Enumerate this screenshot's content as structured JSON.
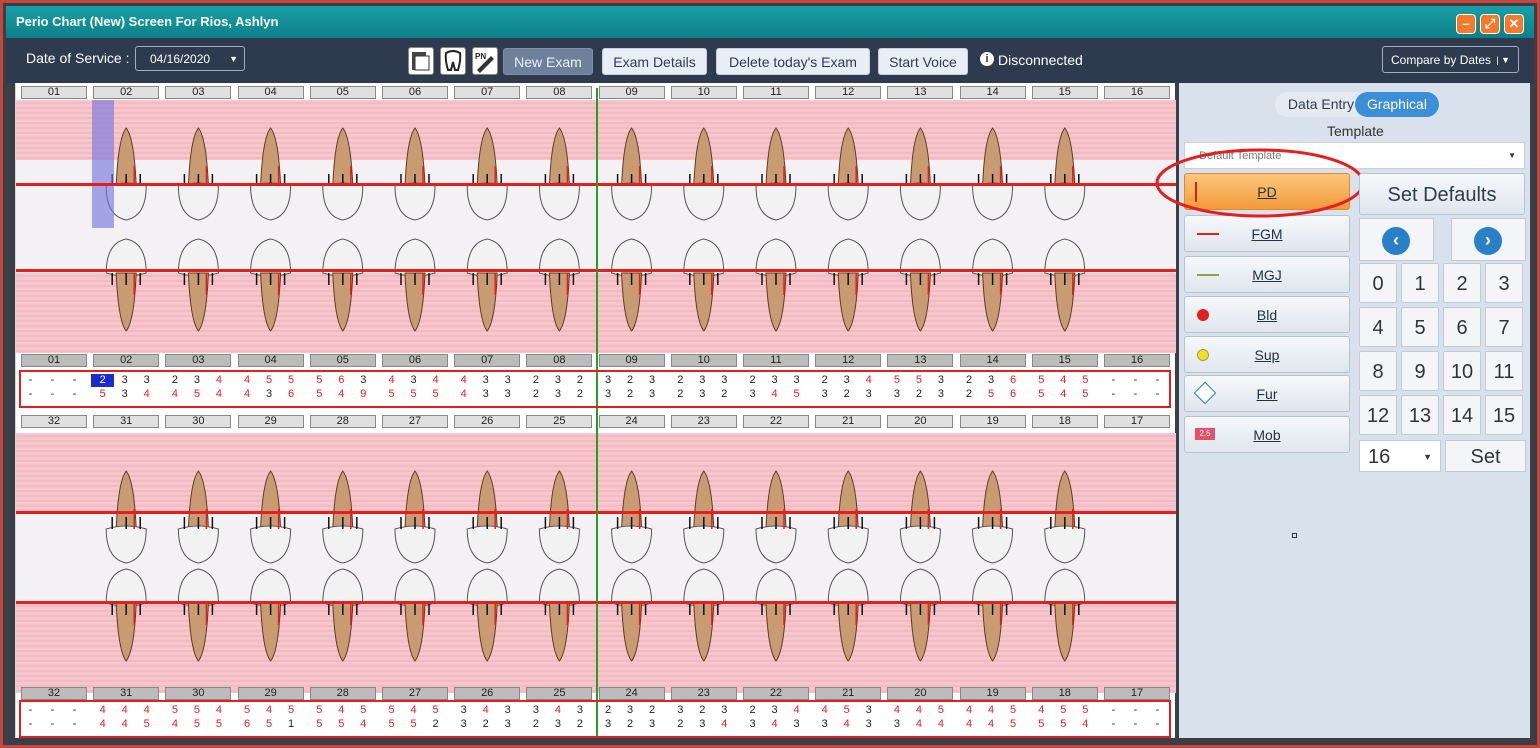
{
  "window": {
    "title": "Perio Chart (New) Screen For Rios, Ashlyn"
  },
  "toolbar": {
    "dos_label": "Date of Service :",
    "dos_value": "04/16/2020",
    "new_exam": "New Exam",
    "exam_details": "Exam Details",
    "delete_exam": "Delete today's Exam",
    "start_voice": "Start Voice",
    "status": "Disconnected",
    "compare": "Compare by Dates"
  },
  "panel": {
    "data_entry": "Data Entry",
    "graphical": "Graphical",
    "template_label": "Template",
    "template_value": "Default Template",
    "set_defaults": "Set Defaults",
    "set": "Set",
    "select_value": "16",
    "buttons": [
      "PD",
      "FGM",
      "MGJ",
      "Bld",
      "Sup",
      "Fur",
      "Mob"
    ],
    "mob_badge": "2.5",
    "numpad": [
      "0",
      "1",
      "2",
      "3",
      "4",
      "5",
      "6",
      "7",
      "8",
      "9",
      "10",
      "11",
      "12",
      "13",
      "14",
      "15"
    ]
  },
  "colors": {
    "accent": "#3a8fd6",
    "pd_active": "#f6a84a",
    "gum": "#f7c6cc",
    "line": "#e32020",
    "midline": "#2a9a2a"
  },
  "upper_teeth": [
    "01",
    "02",
    "03",
    "04",
    "05",
    "06",
    "07",
    "08",
    "09",
    "10",
    "11",
    "12",
    "13",
    "14",
    "15",
    "16"
  ],
  "lower_teeth": [
    "32",
    "31",
    "30",
    "29",
    "28",
    "27",
    "26",
    "25",
    "24",
    "23",
    "22",
    "21",
    "20",
    "19",
    "18",
    "17"
  ],
  "upper_rows": [
    [
      [
        "-",
        "-",
        "-"
      ],
      [
        "2",
        "3",
        "3"
      ],
      [
        "2",
        "3",
        "4"
      ],
      [
        "4",
        "5",
        "5"
      ],
      [
        "5",
        "6",
        "3"
      ],
      [
        "4",
        "3",
        "4"
      ],
      [
        "4",
        "3",
        "3"
      ],
      [
        "2",
        "3",
        "2"
      ],
      [
        "3",
        "2",
        "3"
      ],
      [
        "2",
        "3",
        "3"
      ],
      [
        "2",
        "3",
        "3"
      ],
      [
        "2",
        "3",
        "4"
      ],
      [
        "5",
        "5",
        "3"
      ],
      [
        "2",
        "3",
        "6"
      ],
      [
        "5",
        "4",
        "5"
      ],
      [
        "-",
        "-",
        "-"
      ]
    ],
    [
      [
        "-",
        "-",
        "-"
      ],
      [
        "5",
        "3",
        "4"
      ],
      [
        "4",
        "5",
        "4"
      ],
      [
        "4",
        "3",
        "6"
      ],
      [
        "5",
        "4",
        "9"
      ],
      [
        "5",
        "5",
        "5"
      ],
      [
        "4",
        "3",
        "3"
      ],
      [
        "2",
        "3",
        "2"
      ],
      [
        "3",
        "2",
        "3"
      ],
      [
        "2",
        "3",
        "2"
      ],
      [
        "3",
        "4",
        "5"
      ],
      [
        "3",
        "2",
        "3"
      ],
      [
        "3",
        "2",
        "3"
      ],
      [
        "2",
        "5",
        "6"
      ],
      [
        "5",
        "4",
        "5"
      ],
      [
        "-",
        "-",
        "-"
      ]
    ]
  ],
  "lower_rows": [
    [
      [
        "-",
        "-",
        "-"
      ],
      [
        "4",
        "4",
        "4"
      ],
      [
        "5",
        "5",
        "4"
      ],
      [
        "5",
        "4",
        "5"
      ],
      [
        "5",
        "4",
        "5"
      ],
      [
        "5",
        "4",
        "5"
      ],
      [
        "3",
        "4",
        "3"
      ],
      [
        "3",
        "4",
        "3"
      ],
      [
        "2",
        "3",
        "2"
      ],
      [
        "3",
        "2",
        "3"
      ],
      [
        "2",
        "3",
        "4"
      ],
      [
        "4",
        "5",
        "3"
      ],
      [
        "4",
        "4",
        "5"
      ],
      [
        "4",
        "4",
        "5"
      ],
      [
        "4",
        "5",
        "5"
      ],
      [
        "-",
        "-",
        "-"
      ]
    ],
    [
      [
        "-",
        "-",
        "-"
      ],
      [
        "4",
        "4",
        "5"
      ],
      [
        "4",
        "5",
        "5"
      ],
      [
        "6",
        "5",
        "1"
      ],
      [
        "5",
        "5",
        "4"
      ],
      [
        "5",
        "5",
        "2"
      ],
      [
        "3",
        "2",
        "3"
      ],
      [
        "2",
        "3",
        "2"
      ],
      [
        "3",
        "2",
        "3"
      ],
      [
        "2",
        "3",
        "4"
      ],
      [
        "3",
        "4",
        "3"
      ],
      [
        "3",
        "4",
        "3"
      ],
      [
        "3",
        "4",
        "4"
      ],
      [
        "4",
        "4",
        "5"
      ],
      [
        "5",
        "5",
        "4"
      ],
      [
        "-",
        "-",
        "-"
      ]
    ]
  ]
}
